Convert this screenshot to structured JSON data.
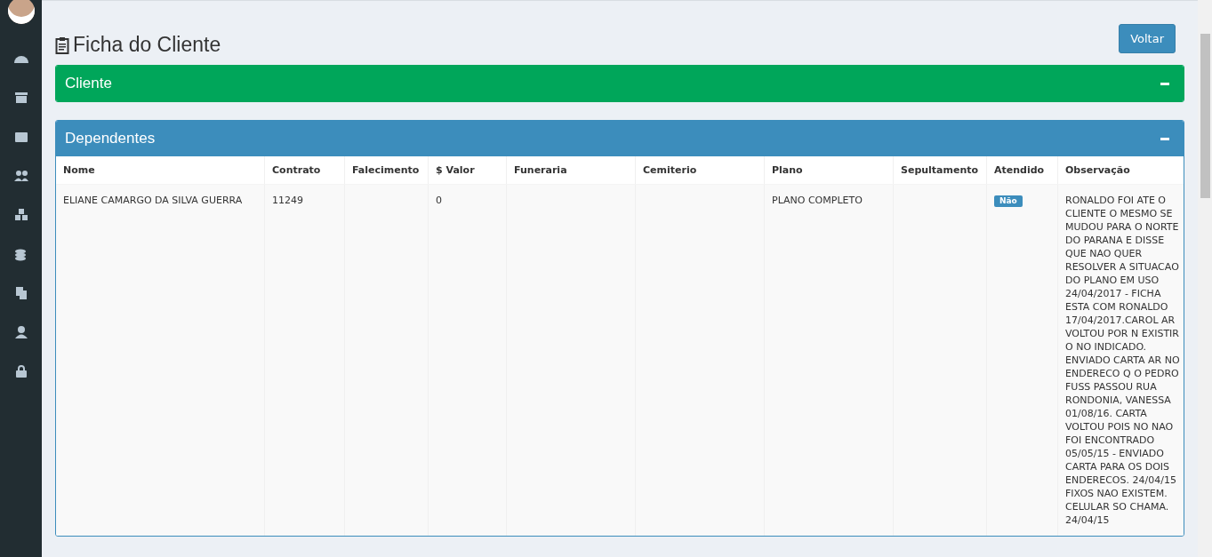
{
  "page": {
    "title": "Ficha do Cliente",
    "back_button": "Voltar"
  },
  "panels": [
    {
      "title": "Cliente",
      "kind": "green"
    },
    {
      "title": "Dependentes",
      "kind": "blue"
    }
  ],
  "table": {
    "columns": [
      "Nome",
      "Contrato",
      "Falecimento",
      "$ Valor",
      "Funeraria",
      "Cemiterio",
      "Plano",
      "Sepultamento",
      "Atendido",
      "Observação"
    ],
    "rows": [
      {
        "cells": [
          "ELIANE CAMARGO DA SILVA GUERRA",
          "11249",
          "",
          "0",
          "",
          "",
          "PLANO COMPLETO",
          ""
        ],
        "atendido": false,
        "atendido_label": "Não",
        "observacao": "RONALDO FOI ATE O CLIENTE O MESMO SE MUDOU PARA O NORTE DO PARANA E DISSE QUE NAO QUER RESOLVER A SITUACAO DO PLANO EM USO 24/04/2017 - FICHA ESTA COM RONALDO 17/04/2017.CAROL AR VOLTOU POR N EXISTIR O NO INDICADO. ENVIADO CARTA AR NO ENDERECO Q O PEDRO FUSS PASSOU RUA RONDONIA, VANESSA 01/08/16. CARTA VOLTOU POIS NO NAO FOI ENCONTRADO 05/05/15 - ENVIADO CARTA PARA OS DOIS ENDERECOS. 24/04/15 FIXOS NAO EXISTEM. CELULAR SO CHAMA. 24/04/15"
      }
    ]
  }
}
